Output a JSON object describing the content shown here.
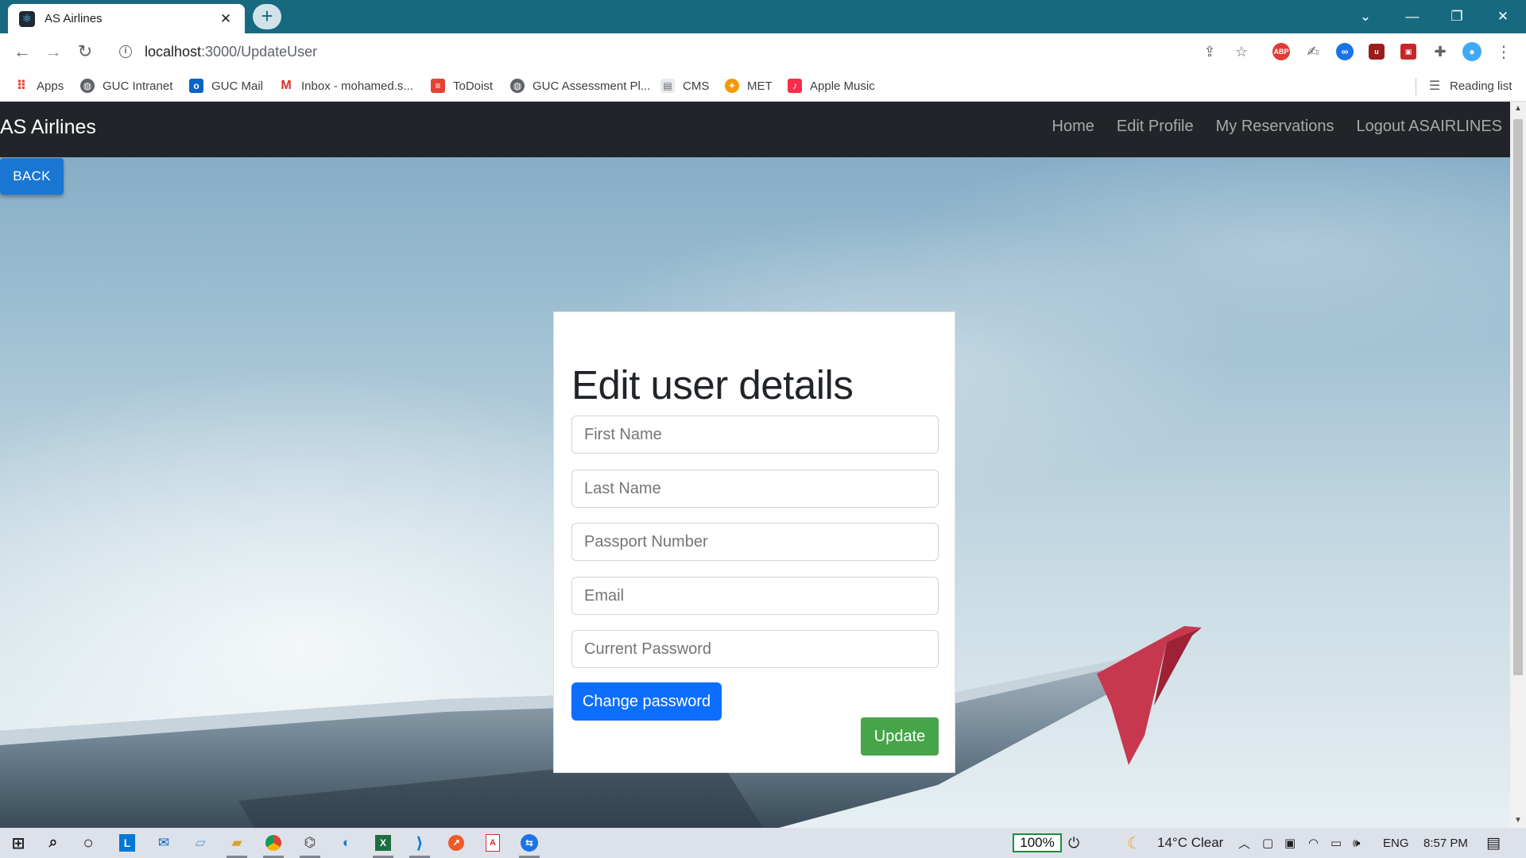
{
  "browser": {
    "tab_title": "AS Airlines",
    "url_host": "localhost",
    "url_path": ":3000/UpdateUser",
    "new_tab_icon": "plus-icon",
    "reading_list": "Reading list"
  },
  "bookmarks": [
    {
      "label": "Apps",
      "icon": "apps-grid-icon"
    },
    {
      "label": "GUC Intranet",
      "icon": "globe-icon"
    },
    {
      "label": "GUC Mail",
      "icon": "outlook-icon"
    },
    {
      "label": "Inbox - mohamed.s...",
      "icon": "gmail-icon"
    },
    {
      "label": "ToDoist",
      "icon": "todoist-icon"
    },
    {
      "label": "GUC Assessment Pl...",
      "icon": "globe-icon"
    },
    {
      "label": "CMS",
      "icon": "document-icon"
    },
    {
      "label": "MET",
      "icon": "met-icon"
    },
    {
      "label": "Apple Music",
      "icon": "apple-music-icon"
    }
  ],
  "navbar": {
    "brand": "AS Airlines",
    "links": [
      "Home",
      "Edit Profile",
      "My Reservations",
      "Logout ASAIRLINES"
    ]
  },
  "back_button": "BACK",
  "form": {
    "title": "Edit user details",
    "fields": [
      {
        "placeholder": "First Name"
      },
      {
        "placeholder": "Last Name"
      },
      {
        "placeholder": "Passport Number"
      },
      {
        "placeholder": "Email"
      },
      {
        "placeholder": "Current Password"
      }
    ],
    "change_password": "Change password",
    "update": "Update"
  },
  "taskbar": {
    "battery": "100%",
    "weather": "14°C  Clear",
    "language": "ENG",
    "time": "8:57 PM"
  },
  "colors": {
    "tab_strip": "#17697f",
    "navbar": "#212529",
    "back_button": "#1976d2",
    "primary": "#0d6efd",
    "success": "#45a548"
  }
}
